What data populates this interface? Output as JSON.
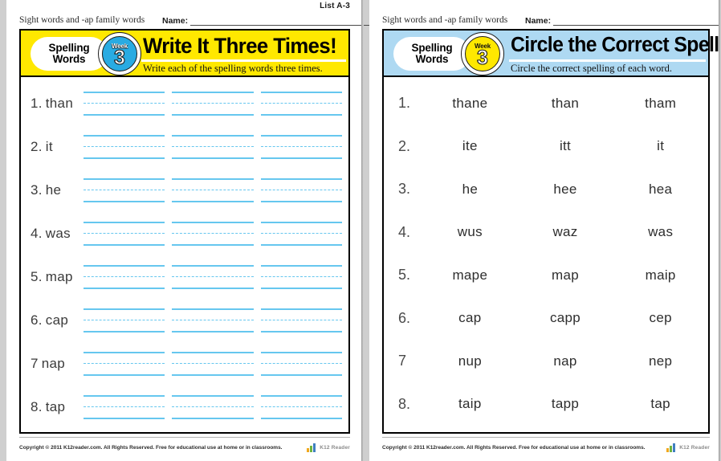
{
  "list_code": "List A-3",
  "left": {
    "description": "Sight words and -ap family words",
    "name_label": "Name:",
    "pill_line1": "Spelling",
    "pill_line2": "Words",
    "badge_week": "Week",
    "badge_number": "3",
    "title": "Write It Three Times!",
    "subtitle": "Write each of  the spelling words three times.",
    "banner_color": "#ffe800",
    "badge_color": "#29abe2",
    "line_color": "#66c7ef",
    "rows": [
      {
        "num": "1.",
        "word": "than"
      },
      {
        "num": "2.",
        "word": "it"
      },
      {
        "num": "3.",
        "word": "he"
      },
      {
        "num": "4.",
        "word": "was"
      },
      {
        "num": "5.",
        "word": "map"
      },
      {
        "num": "6.",
        "word": "cap"
      },
      {
        "num": "7",
        "word": "nap"
      },
      {
        "num": "8.",
        "word": "tap"
      }
    ],
    "footer": {
      "copyright": "Copyright © 2011  K12reader.com. All Rights Reserved. Free for educational use at home or in classrooms.",
      "brand": "K12 Reader"
    }
  },
  "right": {
    "description": "Sight words and -ap family words",
    "name_label": "Name:",
    "pill_line1": "Spelling",
    "pill_line2": "Words",
    "badge_week": "Week",
    "badge_number": "3",
    "title": "Circle the Correct Spelling",
    "subtitle": "Circle the correct spelling of  each word.",
    "banner_color": "#aed9f2",
    "badge_color": "#ffe800",
    "rows": [
      {
        "num": "1.",
        "a": "thane",
        "b": "than",
        "c": "tham"
      },
      {
        "num": "2.",
        "a": "ite",
        "b": "itt",
        "c": "it"
      },
      {
        "num": "3.",
        "a": "he",
        "b": "hee",
        "c": "hea"
      },
      {
        "num": "4.",
        "a": "wus",
        "b": "waz",
        "c": "was"
      },
      {
        "num": "5.",
        "a": "mape",
        "b": "map",
        "c": "maip"
      },
      {
        "num": "6.",
        "a": "cap",
        "b": "capp",
        "c": "cep"
      },
      {
        "num": "7",
        "a": "nup",
        "b": "nap",
        "c": "nep"
      },
      {
        "num": "8.",
        "a": "taip",
        "b": "tapp",
        "c": "tap"
      }
    ],
    "footer": {
      "copyright": "Copyright © 2011  K12reader.com. All Rights Reserved. Free for educational use at home or in classrooms.",
      "brand": "K12 Reader"
    }
  }
}
